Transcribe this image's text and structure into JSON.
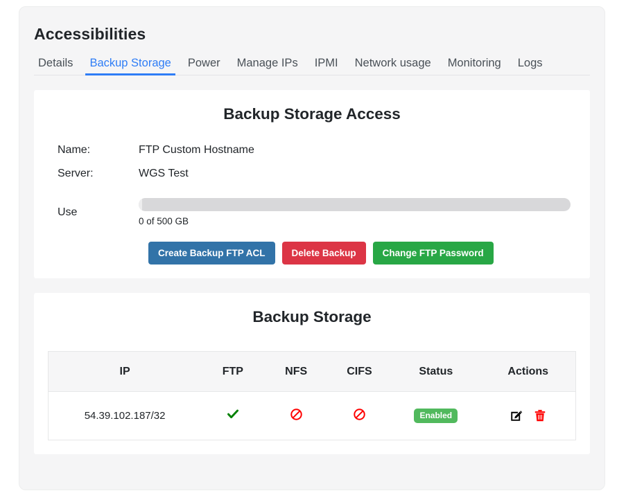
{
  "page": {
    "title": "Accessibilities"
  },
  "tabs": [
    {
      "label": "Details",
      "active": false
    },
    {
      "label": "Backup Storage",
      "active": true
    },
    {
      "label": "Power",
      "active": false
    },
    {
      "label": "Manage IPs",
      "active": false
    },
    {
      "label": "IPMI",
      "active": false
    },
    {
      "label": "Network usage",
      "active": false
    },
    {
      "label": "Monitoring",
      "active": false
    },
    {
      "label": "Logs",
      "active": false
    }
  ],
  "access_card": {
    "title": "Backup Storage Access",
    "fields": [
      {
        "label": "Name:",
        "value": "FTP Custom Hostname"
      },
      {
        "label": "Server:",
        "value": "WGS Test"
      }
    ],
    "usage": {
      "label": "Use",
      "caption": "0 of 500 GB",
      "used_gb": 0,
      "total_gb": 500,
      "percent": 0
    },
    "buttons": [
      {
        "label": "Create Backup FTP ACL",
        "color": "#3273a8"
      },
      {
        "label": "Delete Backup",
        "color": "#dc3545"
      },
      {
        "label": "Change FTP Password",
        "color": "#28a745"
      }
    ]
  },
  "storage_card": {
    "title": "Backup Storage",
    "columns": [
      "IP",
      "FTP",
      "NFS",
      "CIFS",
      "Status",
      "Actions"
    ],
    "rows": [
      {
        "ip": "54.39.102.187/32",
        "ftp": "enabled-check-icon",
        "nfs": "disabled-block-icon",
        "cifs": "disabled-block-icon",
        "status": "Enabled",
        "actions": [
          "edit-icon",
          "delete-icon"
        ]
      }
    ]
  },
  "colors": {
    "accent": "#2e7df6",
    "success": "#28a745",
    "danger": "#dc3545",
    "badge_green": "#51b95d",
    "check_green": "#008000",
    "block_red": "#ff0000"
  }
}
